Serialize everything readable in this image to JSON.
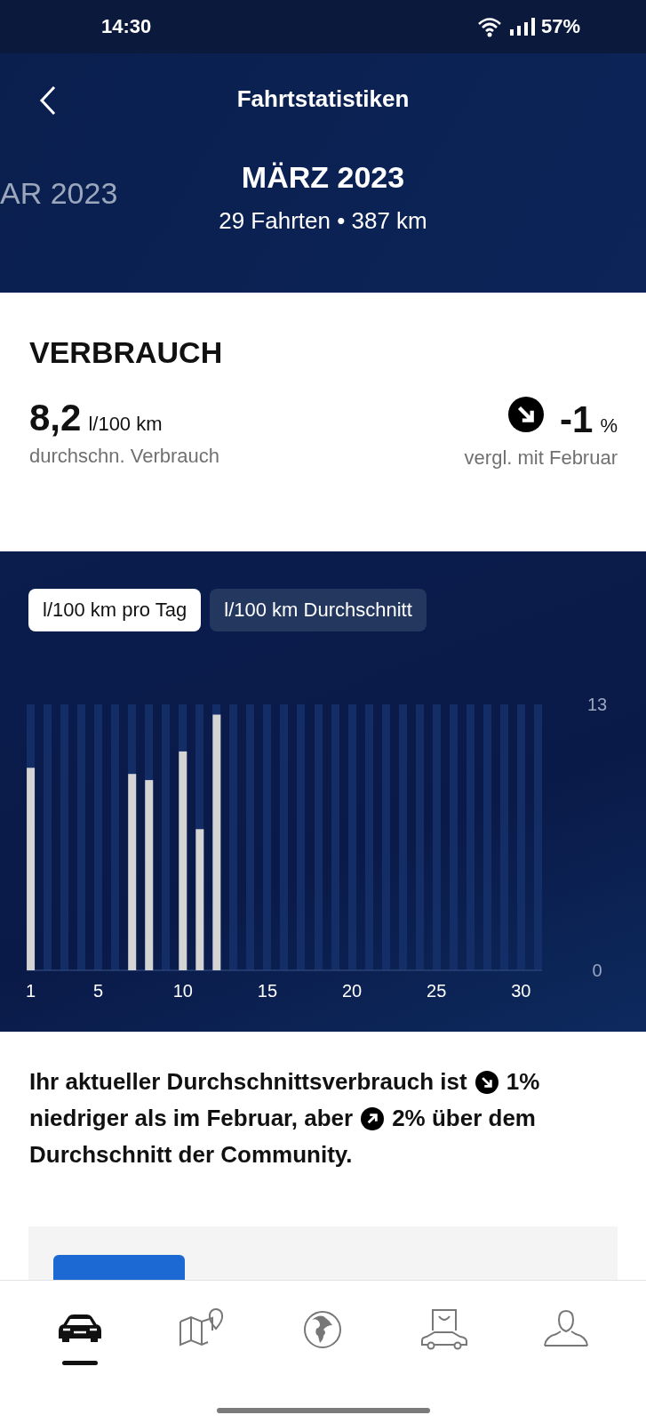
{
  "status_bar": {
    "time": "14:30",
    "battery": "57%"
  },
  "header": {
    "title": "Fahrtstatistiken",
    "previous_month": "AR 2023",
    "month": "MÄRZ 2023",
    "summary": "29 Fahrten • 387 km"
  },
  "consumption": {
    "heading": "VERBRAUCH",
    "value": "8,2",
    "unit": "l/100 km",
    "value_label": "durchschn. Verbrauch",
    "change_down": true,
    "change": "-1",
    "change_unit": "%",
    "change_label": "vergl. mit Februar"
  },
  "chart_tabs": [
    {
      "label": "l/100 km pro Tag",
      "selected": true
    },
    {
      "label": "l/100 km Durchschnitt",
      "selected": false
    }
  ],
  "chart": {
    "chart_data": {
      "type": "bar",
      "x": [
        1,
        7,
        8,
        10,
        11,
        12
      ],
      "values": [
        9.9,
        9.6,
        9.3,
        10.7,
        6.9,
        12.5
      ],
      "xticks": [
        1,
        5,
        10,
        15,
        20,
        25,
        30
      ],
      "xlim": [
        0.76,
        31.24
      ],
      "yticks": [
        0,
        13
      ],
      "ylim": [
        0,
        13
      ]
    }
  },
  "insight": [
    {
      "kind": "text",
      "text": "Ihr aktueller Durchschnittsverbrauch ist"
    },
    {
      "kind": "down_arrow"
    },
    {
      "kind": "text",
      "text": "1%"
    },
    {
      "kind": "text",
      "text": "niedriger als im Februar, aber"
    },
    {
      "kind": "up_arrow"
    },
    {
      "kind": "text",
      "text": "2% über dem"
    },
    {
      "kind": "text",
      "text": "Durchschnitt der Community."
    }
  ],
  "nav": [
    {
      "kind": "car",
      "selected": true
    },
    {
      "kind": "map",
      "selected": false
    },
    {
      "kind": "globe",
      "selected": false
    },
    {
      "kind": "shop",
      "selected": false
    },
    {
      "kind": "profile",
      "selected": false
    }
  ]
}
